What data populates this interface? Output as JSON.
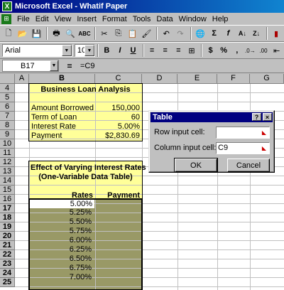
{
  "window": {
    "title": "Microsoft Excel - Whatif Paper"
  },
  "menu": [
    {
      "label": "File"
    },
    {
      "label": "Edit"
    },
    {
      "label": "View"
    },
    {
      "label": "Insert"
    },
    {
      "label": "Format"
    },
    {
      "label": "Tools"
    },
    {
      "label": "Data"
    },
    {
      "label": "Window"
    },
    {
      "label": "Help"
    }
  ],
  "format_toolbar": {
    "font": "Arial",
    "size": "10"
  },
  "formula_bar": {
    "name_box": "B17",
    "equals": "=",
    "formula": "=C9"
  },
  "columns": [
    "A",
    "B",
    "C",
    "D",
    "E",
    "F",
    "G"
  ],
  "rows": [
    "4",
    "5",
    "6",
    "7",
    "8",
    "9",
    "10",
    "11",
    "12",
    "13",
    "14",
    "15",
    "16",
    "17",
    "18",
    "19",
    "20",
    "21",
    "22",
    "23",
    "24",
    "25"
  ],
  "loan": {
    "title": "Business Loan Analysis",
    "amount_label": "Amount Borrowed",
    "amount_value": "150,000",
    "term_label": "Term of Loan",
    "term_value": "60",
    "rate_label": "Interest Rate",
    "rate_value": "5.00%",
    "payment_label": "Payment",
    "payment_value": "$2,830.69"
  },
  "table": {
    "title1": "Effect of Varying Interest Rates",
    "title2": "(One-Variable Data Table)",
    "rates_header": "Rates",
    "payment_header": "Payment",
    "rates": [
      "5.00%",
      "5.25%",
      "5.50%",
      "5.75%",
      "6.00%",
      "6.25%",
      "6.50%",
      "6.75%",
      "7.00%"
    ]
  },
  "dialog": {
    "title": "Table",
    "help_btn": "?",
    "close_btn": "×",
    "row_label": "Row input cell:",
    "row_value": "",
    "col_label": "Column input cell:",
    "col_value": "C9",
    "ok": "OK",
    "cancel": "Cancel"
  }
}
